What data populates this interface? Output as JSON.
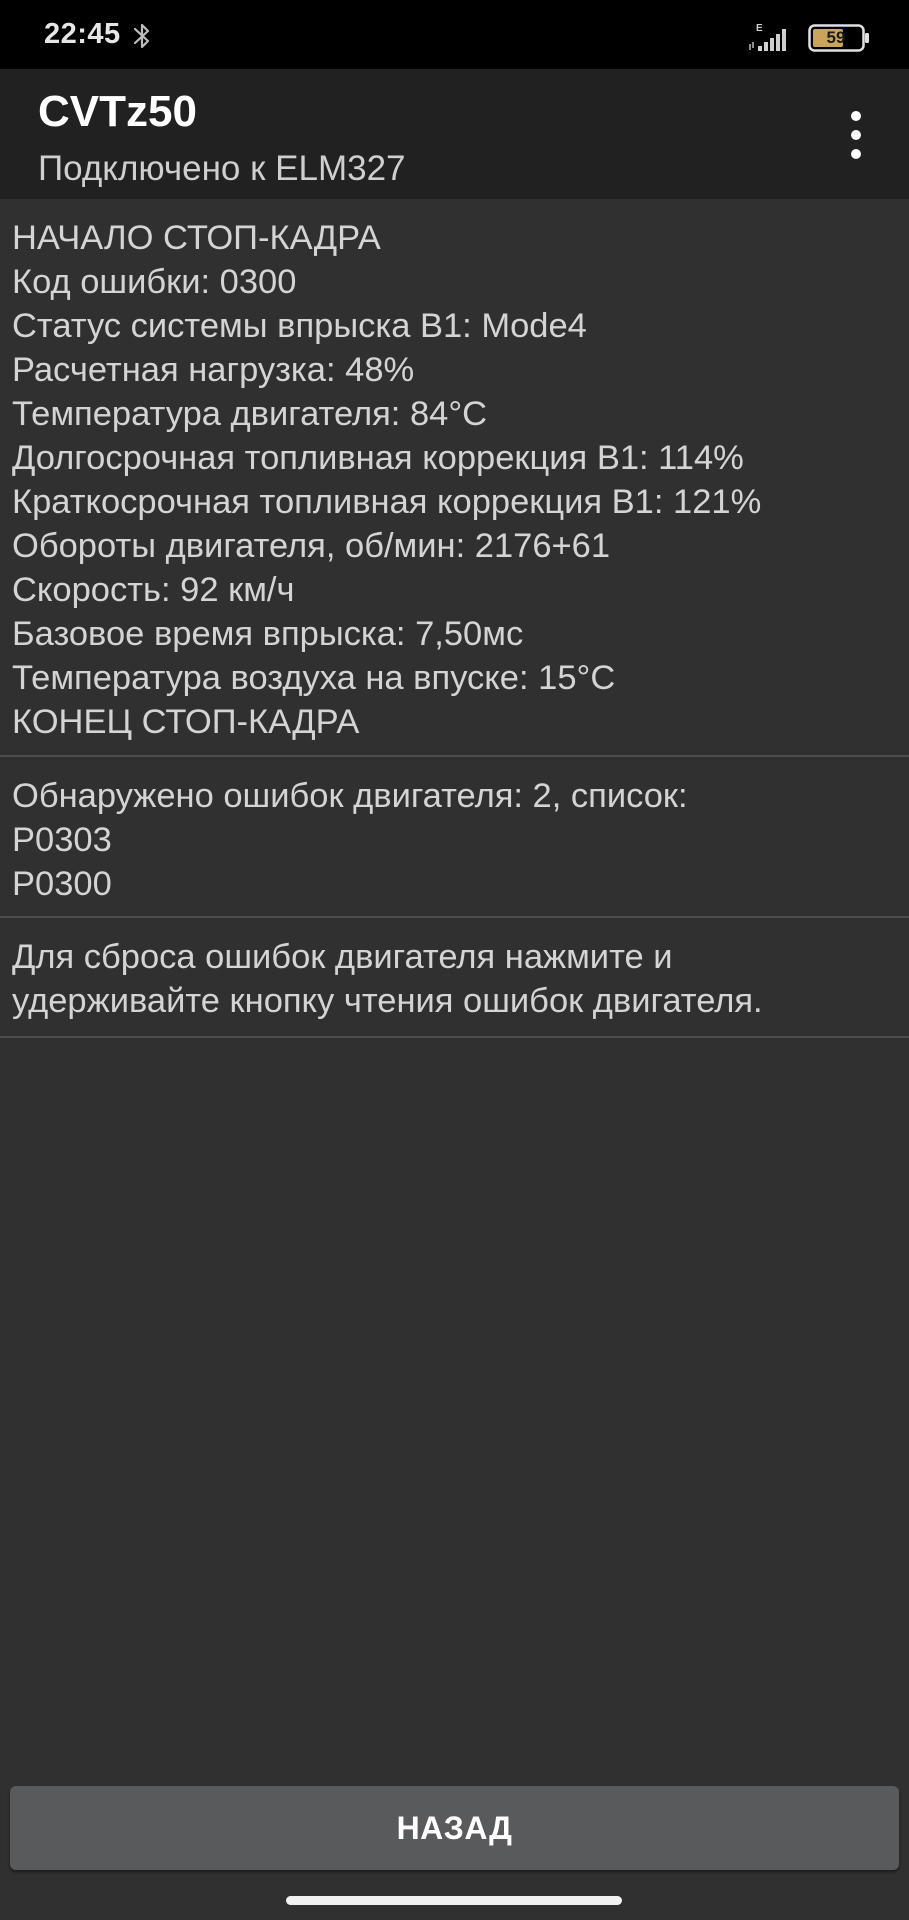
{
  "status_bar": {
    "time": "22:45",
    "network_type": "E",
    "battery_level": "59",
    "icons": [
      "bluetooth-icon",
      "signal-icon",
      "battery-icon"
    ]
  },
  "app_bar": {
    "title": "CVTz50",
    "subtitle": "Подключено к ELM327",
    "menu_icon": "more-vert-icon"
  },
  "freeze_frame": {
    "lines": [
      "НАЧАЛО СТОП-КАДРА",
      "Код ошибки: 0300",
      "Статус системы впрыска B1: Mode4",
      "Расчетная нагрузка: 48%",
      "Температура двигателя: 84°C",
      "Долгосрочная топливная коррекция B1: 114%",
      "Краткосрочная топливная коррекция B1: 121%",
      "Обороты двигателя, об/мин: 2176+61",
      "Скорость: 92 км/ч",
      "Базовое время впрыска: 7,50мс",
      "Температура воздуха на впуске: 15°C",
      "КОНЕЦ СТОП-КАДРА"
    ]
  },
  "errors": {
    "lines": [
      "Обнаружено ошибок двигателя: 2, список:",
      "P0303",
      "P0300"
    ]
  },
  "hint": {
    "lines": [
      "Для сброса ошибок двигателя нажмите и",
      "удерживайте кнопку чтения ошибок двигателя."
    ]
  },
  "back_button": {
    "label": "НАЗАД"
  },
  "colors": {
    "background": "#303030",
    "app_bar": "#212121",
    "status_bar": "#000000",
    "button": "#595a5c",
    "divider": "#4d4d4d",
    "battery_fill": "#c8a55a"
  }
}
